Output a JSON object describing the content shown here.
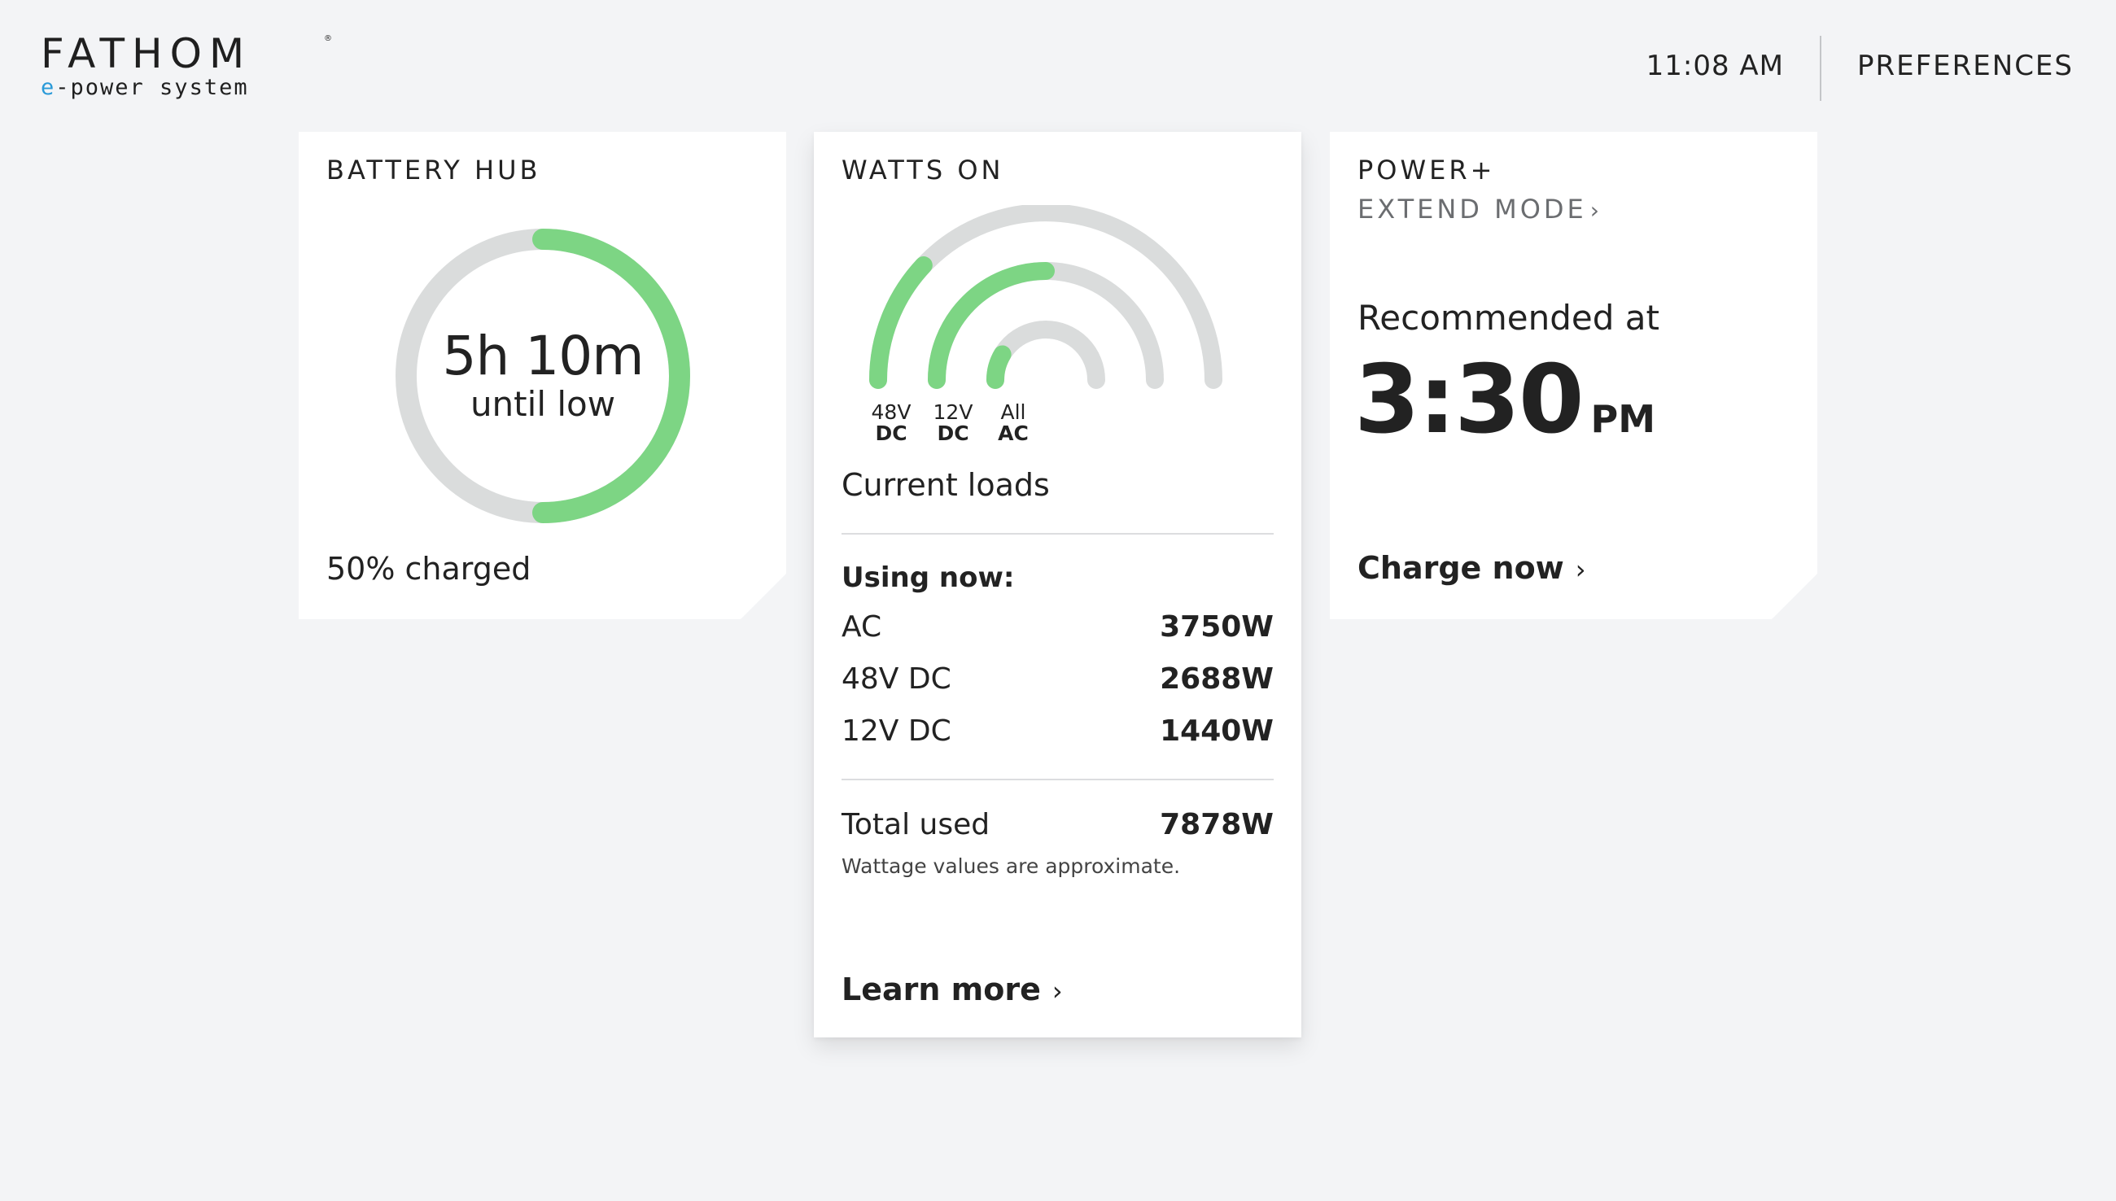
{
  "header": {
    "logo_word": "FATHOM",
    "logo_reg": "®",
    "logo_tagline_prefix": "e",
    "logo_tagline_rest": "-power system",
    "time": "11:08 AM",
    "preferences_label": "PREFERENCES"
  },
  "battery_hub": {
    "title": "BATTERY HUB",
    "time_remaining": "5h 10m",
    "time_caption": "until low",
    "charge_percent": 50,
    "charged_label": "50% charged"
  },
  "watts_on": {
    "title": "WATTS ON",
    "arcs": [
      {
        "line1": "48V",
        "line2": "DC",
        "fill_fraction": 0.24
      },
      {
        "line1": "12V",
        "line2": "DC",
        "fill_fraction": 0.5
      },
      {
        "line1": "All",
        "line2": "AC",
        "fill_fraction": 0.17
      }
    ],
    "current_loads_label": "Current loads",
    "using_now_label": "Using now:",
    "loads": [
      {
        "label": "AC",
        "value": "3750W"
      },
      {
        "label": "48V DC",
        "value": "2688W"
      },
      {
        "label": "12V DC",
        "value": "1440W"
      }
    ],
    "total_label": "Total used",
    "total_value": "7878W",
    "note": "Wattage values are approximate.",
    "learn_more_label": "Learn more"
  },
  "power_plus": {
    "title": "POWER+",
    "mode_label": "EXTEND MODE",
    "recommended_label": "Recommended at",
    "recommended_time": "3:30",
    "recommended_ampm": "PM",
    "charge_now_label": "Charge now"
  },
  "colors": {
    "accent_green": "#7dd584",
    "track_gray": "#dadcdc",
    "logo_blue": "#2a9ad8",
    "background": "#f3f4f6"
  },
  "icons": {
    "chevron": "chevron-right-icon"
  }
}
